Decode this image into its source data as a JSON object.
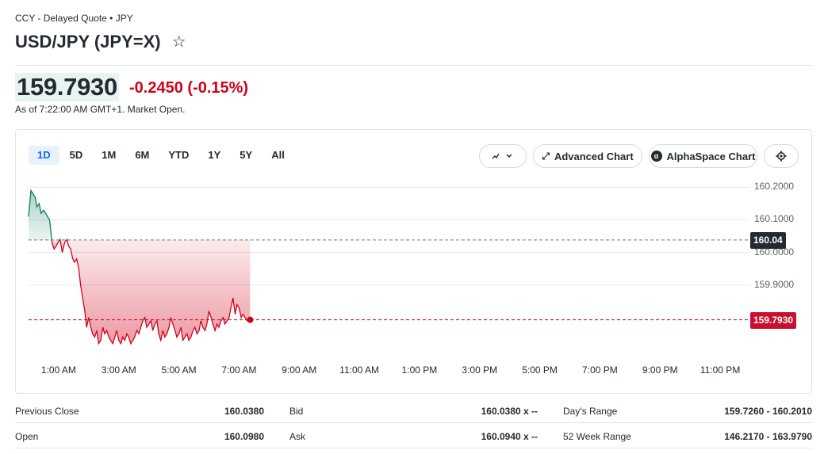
{
  "header": {
    "subtitle": "CCY - Delayed Quote • JPY",
    "title": "USD/JPY (JPY=X)",
    "star_icon": "☆"
  },
  "quote": {
    "price": "159.7930",
    "change": "-0.2450",
    "change_pct": "(-0.15%)",
    "as_of": "As of 7:22:00 AM GMT+1. Market Open.",
    "change_color": "#d0021b"
  },
  "chart_controls": {
    "ranges": [
      "1D",
      "5D",
      "1M",
      "6M",
      "YTD",
      "1Y",
      "5Y",
      "All"
    ],
    "active_range": "1D",
    "chart_type_icon": "line-chart-icon",
    "advanced_chart_label": "Advanced Chart",
    "alphaspace_label": "AlphaSpace Chart",
    "settings_icon": "gear-icon"
  },
  "chart_data": {
    "type": "area",
    "title": "",
    "xlabel": "",
    "ylabel": "",
    "y_ticks": [
      "160.2000",
      "160.1000",
      "160.0000",
      "159.9000"
    ],
    "y_tick_values": [
      160.2,
      160.1,
      160.0,
      159.9
    ],
    "ylim": [
      159.69,
      160.23
    ],
    "x_ticks": [
      "1:00 AM",
      "3:00 AM",
      "5:00 AM",
      "7:00 AM",
      "9:00 AM",
      "11:00 AM",
      "1:00 PM",
      "3:00 PM",
      "5:00 PM",
      "7:00 PM",
      "9:00 PM",
      "11:00 PM"
    ],
    "x_tick_hours": [
      1,
      3,
      5,
      7,
      9,
      11,
      13,
      15,
      17,
      19,
      21,
      23
    ],
    "xlim_hours": [
      0.0,
      24.0
    ],
    "previous_close_tag": "160.04",
    "previous_close": 160.038,
    "last_price_tag": "159.7930",
    "last_price": 159.793,
    "up_color": "#0b7d5c",
    "down_color": "#d0021b",
    "series": [
      {
        "x_hours": [
          0.0,
          0.08,
          0.15,
          0.22,
          0.28,
          0.35,
          0.42,
          0.5,
          0.57,
          0.63,
          0.7,
          0.78,
          0.85,
          0.92,
          0.98,
          1.05,
          1.12,
          1.2,
          1.27,
          1.33,
          1.4,
          1.47,
          1.53,
          1.6,
          1.67,
          1.73,
          1.8,
          1.87,
          1.93,
          2.0,
          2.07,
          2.13,
          2.2,
          2.27,
          2.33,
          2.4,
          2.47,
          2.53,
          2.6,
          2.67,
          2.73,
          2.8,
          2.87,
          2.93,
          3.0,
          3.07,
          3.13,
          3.2,
          3.27,
          3.33,
          3.4,
          3.47,
          3.53,
          3.6,
          3.67,
          3.73,
          3.8,
          3.87,
          3.93,
          4.0,
          4.07,
          4.13,
          4.2,
          4.27,
          4.33,
          4.4,
          4.47,
          4.53,
          4.6,
          4.67,
          4.73,
          4.8,
          4.87,
          4.93,
          5.0,
          5.07,
          5.13,
          5.2,
          5.27,
          5.33,
          5.4,
          5.47,
          5.53,
          5.6,
          5.67,
          5.73,
          5.8,
          5.87,
          5.93,
          6.0,
          6.07,
          6.13,
          6.2,
          6.27,
          6.33,
          6.4,
          6.47,
          6.53,
          6.6,
          6.67,
          6.73,
          6.8,
          6.87,
          6.93,
          7.0,
          7.07,
          7.13,
          7.2,
          7.27,
          7.37
        ],
        "values": [
          160.11,
          160.19,
          160.18,
          160.17,
          160.14,
          160.15,
          160.12,
          160.13,
          160.12,
          160.11,
          160.1,
          160.03,
          160.01,
          160.02,
          160.03,
          160.04,
          160.0,
          160.03,
          160.04,
          160.02,
          160.01,
          159.98,
          159.97,
          159.98,
          159.95,
          159.9,
          159.86,
          159.82,
          159.77,
          159.8,
          159.77,
          159.75,
          159.74,
          159.76,
          159.72,
          159.73,
          159.77,
          159.75,
          159.76,
          159.74,
          159.73,
          159.72,
          159.74,
          159.76,
          159.73,
          159.72,
          159.74,
          159.73,
          159.75,
          159.74,
          159.72,
          159.73,
          159.74,
          159.76,
          159.75,
          159.77,
          159.79,
          159.8,
          159.77,
          159.78,
          159.79,
          159.76,
          159.78,
          159.79,
          159.75,
          159.73,
          159.76,
          159.74,
          159.75,
          159.77,
          159.8,
          159.78,
          159.76,
          159.74,
          159.75,
          159.77,
          159.73,
          159.74,
          159.75,
          159.73,
          159.74,
          159.76,
          159.77,
          159.75,
          159.76,
          159.79,
          159.77,
          159.76,
          159.78,
          159.82,
          159.8,
          159.78,
          159.76,
          159.78,
          159.77,
          159.79,
          159.8,
          159.78,
          159.79,
          159.8,
          159.83,
          159.86,
          159.81,
          159.84,
          159.83,
          159.8,
          159.81,
          159.8,
          159.79,
          159.793
        ]
      }
    ]
  },
  "stats": {
    "rows": [
      {
        "l1": "Previous Close",
        "v1": "160.0380",
        "l2": "Bid",
        "v2": "160.0380 x --",
        "l3": "Day's Range",
        "v3": "159.7260 - 160.2010"
      },
      {
        "l1": "Open",
        "v1": "160.0980",
        "l2": "Ask",
        "v2": "160.0940 x --",
        "l3": "52 Week Range",
        "v3": "146.2170 - 163.9790"
      }
    ]
  }
}
